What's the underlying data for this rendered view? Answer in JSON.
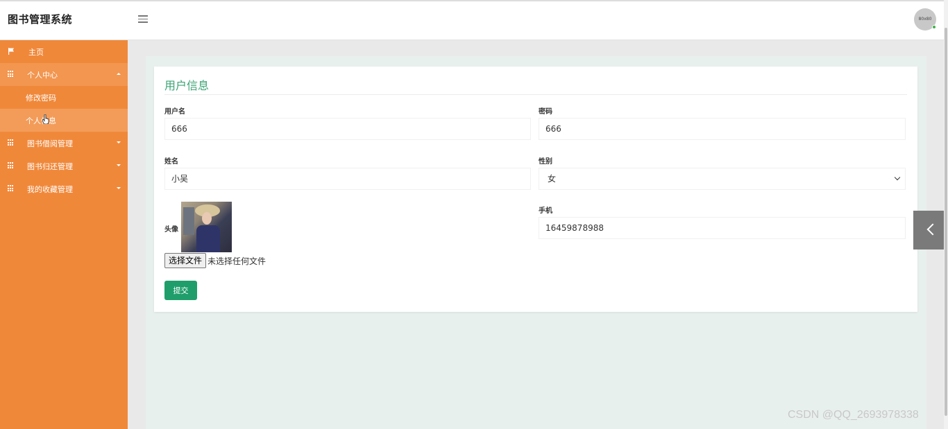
{
  "header": {
    "brand": "图书管理系统",
    "avatar_text": "80x80"
  },
  "sidebar": {
    "items": [
      {
        "label": "主页",
        "icon": "flag-icon"
      },
      {
        "label": "个人中心",
        "icon": "grid-icon",
        "expanded": true,
        "children": [
          {
            "label": "修改密码"
          },
          {
            "label": "个人信息",
            "current": true
          }
        ]
      },
      {
        "label": "图书借阅管理",
        "icon": "grid-icon"
      },
      {
        "label": "图书归还管理",
        "icon": "grid-icon"
      },
      {
        "label": "我的收藏管理",
        "icon": "grid-icon"
      }
    ]
  },
  "form": {
    "title": "用户信息",
    "username_label": "用户名",
    "username_value": "666",
    "password_label": "密码",
    "password_value": "666",
    "name_label": "姓名",
    "name_value": "小吴",
    "gender_label": "性别",
    "gender_value": "女",
    "avatar_label": "头像",
    "phone_label": "手机",
    "phone_value": "16459878988",
    "file_button": "选择文件",
    "file_status": "未选择任何文件",
    "submit": "提交"
  },
  "watermark": "CSDN @QQ_2693978338",
  "colors": {
    "sidebar": "#f0883a",
    "accent_title": "#3aa374",
    "submit": "#1f9e6b"
  }
}
